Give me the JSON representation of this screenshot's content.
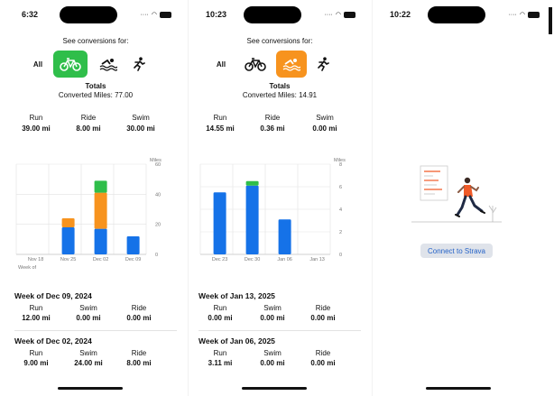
{
  "colors": {
    "ride": "#2fbe4a",
    "swim": "#f7931e",
    "run": "#1572e8",
    "connect_bg": "#dfe3ea",
    "connect_text": "#2563c8"
  },
  "phones": [
    {
      "time": "6:32",
      "see_conversions": "See conversions for:",
      "all_label": "All",
      "selected": "ride",
      "totals_label": "Totals",
      "converted": "Converted Miles: 77.00",
      "summary": [
        {
          "label": "Run",
          "value": "39.00 mi"
        },
        {
          "label": "Ride",
          "value": "8.00 mi"
        },
        {
          "label": "Swim",
          "value": "30.00 mi"
        }
      ],
      "chart_data": {
        "type": "bar",
        "ylabel": "Miles",
        "xlabel": "Week of",
        "ylim": [
          0,
          60
        ],
        "yticks": [
          "0",
          "20",
          "40",
          "60"
        ],
        "categories": [
          "Nov 18",
          "Nov 25",
          "Dec 02",
          "Dec 09"
        ],
        "series": [
          {
            "name": "Run",
            "color": "#1572e8",
            "values": [
              0,
              18,
              17,
              12
            ]
          },
          {
            "name": "Swim",
            "color": "#f7931e",
            "values": [
              0,
              6,
              24,
              0
            ]
          },
          {
            "name": "Ride",
            "color": "#2fbe4a",
            "values": [
              0,
              0,
              8,
              0
            ]
          }
        ]
      },
      "weeks": [
        {
          "title": "Week of Dec 09, 2024",
          "cols": [
            {
              "label": "Run",
              "value": "12.00 mi"
            },
            {
              "label": "Swim",
              "value": "0.00 mi"
            },
            {
              "label": "Ride",
              "value": "0.00 mi"
            }
          ]
        },
        {
          "title": "Week of Dec 02, 2024",
          "cols": [
            {
              "label": "Run",
              "value": "9.00 mi"
            },
            {
              "label": "Swim",
              "value": "24.00 mi"
            },
            {
              "label": "Ride",
              "value": "8.00 mi"
            }
          ]
        }
      ]
    },
    {
      "time": "10:23",
      "see_conversions": "See conversions for:",
      "all_label": "All",
      "selected": "swim",
      "totals_label": "Totals",
      "converted": "Converted Miles: 14.91",
      "summary": [
        {
          "label": "Run",
          "value": "14.55 mi"
        },
        {
          "label": "Ride",
          "value": "0.36 mi"
        },
        {
          "label": "Swim",
          "value": "0.00 mi"
        }
      ],
      "chart_data": {
        "type": "bar",
        "ylabel": "Miles",
        "xlabel": "",
        "ylim": [
          0,
          8
        ],
        "yticks": [
          "0",
          "2",
          "4",
          "6",
          "8"
        ],
        "categories": [
          "Dec 23",
          "Dec 30",
          "Jan 06",
          "Jan 13"
        ],
        "series": [
          {
            "name": "Run",
            "color": "#1572e8",
            "values": [
              5.5,
              6.1,
              3.1,
              0
            ]
          },
          {
            "name": "Ride",
            "color": "#2fbe4a",
            "values": [
              0,
              0.4,
              0,
              0
            ]
          }
        ]
      },
      "weeks": [
        {
          "title": "Week of Jan 13, 2025",
          "cols": [
            {
              "label": "Run",
              "value": "0.00 mi"
            },
            {
              "label": "Swim",
              "value": "0.00 mi"
            },
            {
              "label": "Ride",
              "value": "0.00 mi"
            }
          ]
        },
        {
          "title": "Week of Jan 06, 2025",
          "cols": [
            {
              "label": "Run",
              "value": "3.11 mi"
            },
            {
              "label": "Swim",
              "value": "0.00 mi"
            },
            {
              "label": "Ride",
              "value": "0.00 mi"
            }
          ]
        }
      ]
    },
    {
      "time": "10:22",
      "connect_label": "Connect to Strava"
    }
  ]
}
